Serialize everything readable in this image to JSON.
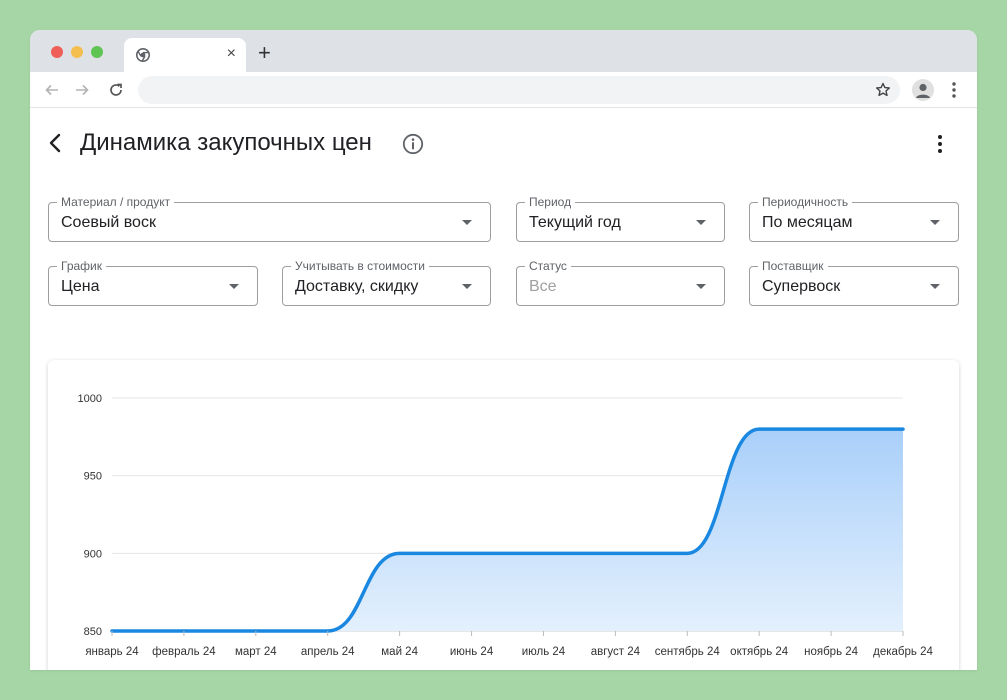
{
  "browser": {
    "tab_close": "×",
    "new_tab": "+",
    "address_value": ""
  },
  "page": {
    "title": "Динамика закупочных цен"
  },
  "filters": {
    "material": {
      "label": "Материал / продукт",
      "value": "Соевый воск"
    },
    "period": {
      "label": "Период",
      "value": "Текущий год"
    },
    "frequency": {
      "label": "Периодичность",
      "value": "По месяцам"
    },
    "chart": {
      "label": "График",
      "value": "Цена"
    },
    "include_cost": {
      "label": "Учитывать в стоимости",
      "value": "Доставку, скидку"
    },
    "status": {
      "label": "Статус",
      "value": "Все"
    },
    "supplier": {
      "label": "Поставщик",
      "value": "Супервоск"
    }
  },
  "colors": {
    "line": "#1a88e0",
    "area_top": "#a9cffa",
    "area_bottom": "#e3f0fd",
    "grid": "#e6e6e6"
  },
  "chart_data": {
    "type": "area",
    "title": "",
    "xlabel": "",
    "ylabel": "",
    "categories": [
      "январь 24",
      "февраль 24",
      "март 24",
      "апрель 24",
      "май 24",
      "июнь 24",
      "июль 24",
      "август 24",
      "сентябрь 24",
      "октябрь 24",
      "ноябрь 24",
      "декабрь 24"
    ],
    "values": [
      850,
      850,
      850,
      850,
      900,
      900,
      900,
      900,
      900,
      980,
      980,
      980
    ],
    "ylim": [
      850,
      1000
    ],
    "yticks": [
      850,
      900,
      950,
      1000
    ],
    "grid": true,
    "legend": "none"
  }
}
